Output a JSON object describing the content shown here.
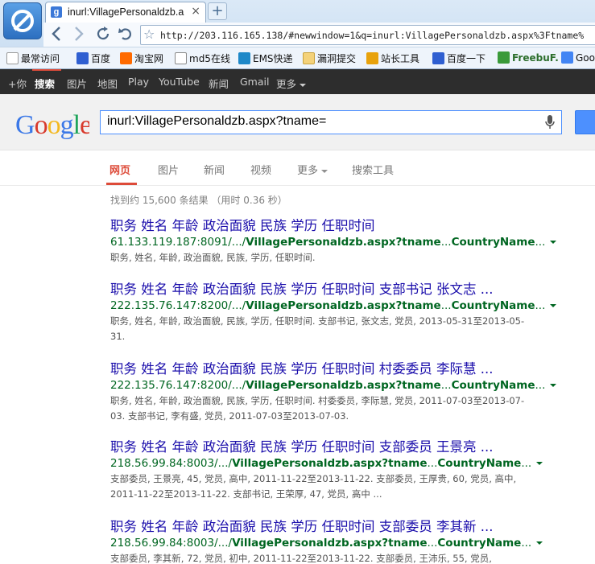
{
  "browser": {
    "tab_title": "inurl:VillagePersonaldzb.a",
    "tab_favicon": "g",
    "tab_close": "×",
    "new_tab": "+",
    "address": "http://203.116.165.138/#newwindow=1&q=inurl:VillagePersonaldzb.aspx%3Ftname%",
    "icons": [
      "back-icon",
      "forward-icon",
      "reload-icon",
      "undo-icon",
      "star-icon"
    ]
  },
  "bookmarks": [
    {
      "label": "最常访问",
      "color": "#d9d9d9"
    },
    {
      "label": "百度",
      "color": "#2f5fd1"
    },
    {
      "label": "淘宝网",
      "color": "#ff6a00"
    },
    {
      "label": "md5在线",
      "color": "#6a6a6a"
    },
    {
      "label": "EMS快递",
      "color": "#1e88c8"
    },
    {
      "label": "漏洞提交",
      "color": "#f4d27a"
    },
    {
      "label": "站长工具",
      "color": "#e8a20c"
    },
    {
      "label": "百度一下",
      "color": "#2f5fd1"
    },
    {
      "label": "FreebuF.",
      "color": "#3a9a3a"
    },
    {
      "label": "Goo",
      "color": "#4285f4"
    }
  ],
  "gbar": [
    "+你",
    "搜索",
    "图片",
    "地图",
    "Play",
    "YouTube",
    "新闻",
    "Gmail",
    "更多"
  ],
  "search": {
    "query": "inurl:VillagePersonaldzb.aspx?tname=",
    "logo": "Google"
  },
  "tabs": [
    "网页",
    "图片",
    "新闻",
    "视频",
    "更多",
    "搜索工具"
  ],
  "stats": "找到约 15,600 条结果 （用时 0.36 秒）",
  "results": [
    {
      "title": "职务 姓名 年龄 政治面貌 民族 学历 任职时间",
      "url_host": "61.133.119.187:8091/.../",
      "url_bold": "VillagePersonaldzb.aspx?tname",
      "url_mid": "...",
      "url_bold2": "CountryName",
      "url_end": "...",
      "snippet": "职务, 姓名, 年龄, 政治面貌, 民族, 学历, 任职时间."
    },
    {
      "title": "职务 姓名 年龄 政治面貌 民族 学历 任职时间 支部书记 张文志 ...",
      "url_host": "222.135.76.147:8200/.../",
      "url_bold": "VillagePersonaldzb.aspx?tname",
      "url_mid": "...",
      "url_bold2": "CountryName",
      "url_end": "...",
      "snippet": "职务, 姓名, 年龄, 政治面貌, 民族, 学历, 任职时间. 支部书记, 张文志, 党员, 2013-05-31至2013-05-31."
    },
    {
      "title": "职务 姓名 年龄 政治面貌 民族 学历 任职时间 村委委员 李际慧 ...",
      "url_host": "222.135.76.147:8200/.../",
      "url_bold": "VillagePersonaldzb.aspx?tname",
      "url_mid": "...",
      "url_bold2": "CountryName",
      "url_end": "...",
      "snippet": "职务, 姓名, 年龄, 政治面貌, 民族, 学历, 任职时间. 村委委员, 李际慧, 党员, 2011-07-03至2013-07-03. 支部书记, 李有盛, 党员, 2011-07-03至2013-07-03."
    },
    {
      "title": "职务 姓名 年龄 政治面貌 民族 学历 任职时间 支部委员 王景亮 ...",
      "url_host": "218.56.99.84:8003/.../",
      "url_bold": "VillagePersonaldzb.aspx?tname",
      "url_mid": "...",
      "url_bold2": "CountryName",
      "url_end": "...",
      "snippet": "支部委员, 王景亮, 45, 党员, 高中, 2011-11-22至2013-11-22. 支部委员, 王厚贵, 60, 党员, 高中, 2011-11-22至2013-11-22. 支部书记, 王荣厚, 47, 党员, 高中 ..."
    },
    {
      "title": "职务 姓名 年龄 政治面貌 民族 学历 任职时间 支部委员 李其新 ...",
      "url_host": "218.56.99.84:8003/.../",
      "url_bold": "VillagePersonaldzb.aspx?tname",
      "url_mid": "...",
      "url_bold2": "CountryName",
      "url_end": "...",
      "snippet": "支部委员, 李其新, 72, 党员, 初中, 2011-11-22至2013-11-22. 支部委员, 王沛乐, 55, 党员,"
    }
  ]
}
